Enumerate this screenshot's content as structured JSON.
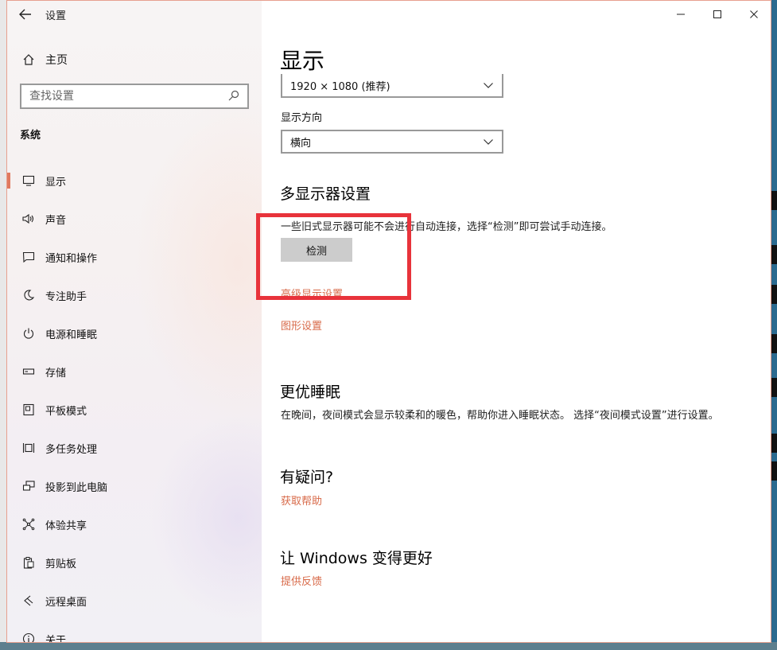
{
  "window": {
    "title": "设置",
    "back_label": "←"
  },
  "sidebar": {
    "home_label": "主页",
    "search_placeholder": "查找设置",
    "section_label": "系统",
    "items": [
      {
        "label": "显示",
        "icon": "monitor-icon",
        "active": true
      },
      {
        "label": "声音",
        "icon": "speaker-icon"
      },
      {
        "label": "通知和操作",
        "icon": "notification-icon"
      },
      {
        "label": "专注助手",
        "icon": "moon-icon"
      },
      {
        "label": "电源和睡眠",
        "icon": "power-icon"
      },
      {
        "label": "存储",
        "icon": "storage-icon"
      },
      {
        "label": "平板模式",
        "icon": "tablet-icon"
      },
      {
        "label": "多任务处理",
        "icon": "multitask-icon"
      },
      {
        "label": "投影到此电脑",
        "icon": "project-icon"
      },
      {
        "label": "体验共享",
        "icon": "share-icon"
      },
      {
        "label": "剪贴板",
        "icon": "clipboard-icon"
      },
      {
        "label": "远程桌面",
        "icon": "remote-desktop-icon"
      },
      {
        "label": "关于",
        "icon": "info-icon"
      }
    ]
  },
  "main": {
    "title": "显示",
    "resolution_value": "1920 × 1080 (推荐)",
    "orientation_label": "显示方向",
    "orientation_value": "横向",
    "multi_display": {
      "heading": "多显示器设置",
      "description": "一些旧式显示器可能不会进行自动连接，选择“检测”即可尝试手动连接。",
      "detect_button": "检测",
      "advanced_link": "高级显示设置",
      "graphics_link": "图形设置"
    },
    "sleep": {
      "heading": "更优睡眠",
      "description": "在晚间，夜间模式会显示较柔和的暖色，帮助你进入睡眠状态。 选择“夜间模式设置”进行设置。"
    },
    "questions": {
      "heading": "有疑问?",
      "link": "获取帮助"
    },
    "feedback": {
      "heading": "让 Windows 变得更好",
      "link": "提供反馈"
    }
  },
  "colors": {
    "accent": "#e07a5f",
    "link": "#d86a49",
    "highlight": "#e8333b"
  }
}
